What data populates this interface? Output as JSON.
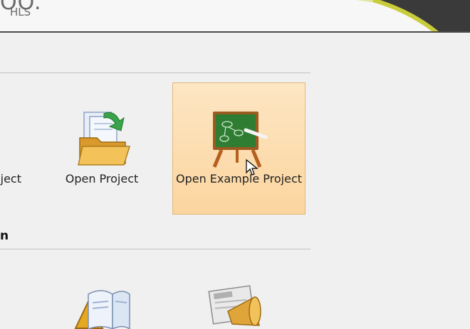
{
  "header": {
    "logo_fragment": "OO.",
    "logo_sub": "HLS"
  },
  "tiles": {
    "new_project_label": "ject",
    "open_project_label": "Open Project",
    "open_example_label": "Open Example Project"
  },
  "section": {
    "title": "n"
  },
  "colors": {
    "tile_highlight": "#fbd59e",
    "swoosh_yellow": "#c9cc3a",
    "swoosh_dark": "#3a3a3a"
  },
  "icons": [
    "open-folder-icon",
    "example-chalkboard-icon",
    "book-icon",
    "news-megaphone-icon"
  ]
}
